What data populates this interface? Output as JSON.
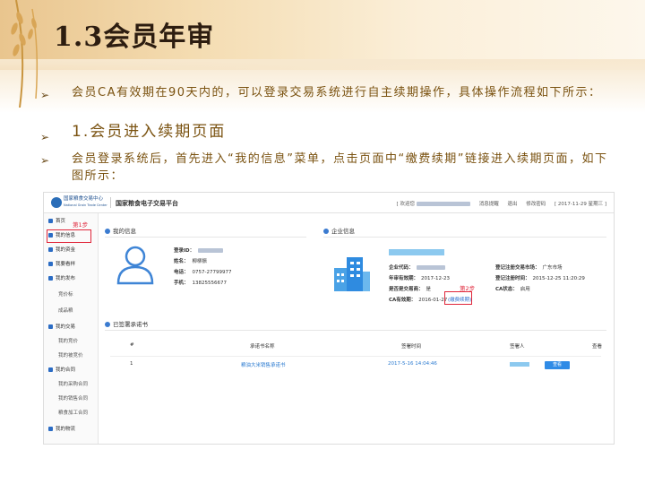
{
  "slide": {
    "title": "1.3会员年审",
    "bullets": [
      {
        "mark": "➢",
        "text": "会员CA有效期在90天内的，可以登录交易系统进行自主续期操作，具体操作流程如下所示："
      },
      {
        "mark": "➢",
        "text": "1.会员进入续期页面"
      },
      {
        "mark": "➢",
        "text": "会员登录系统后，首先进入“我的信息”菜单，点击页面中“缴费续期”链接进入续期页面，如下图所示："
      }
    ]
  },
  "screenshot": {
    "logo_text_cn": "国家粮食交易中心",
    "logo_text_en": "National Grain Trade Center",
    "platform": "国家粮食电子交易平台",
    "top_links": [
      "[ 欢迎您",
      "消息提醒",
      "退出",
      "修改密码",
      "[ 2017-11-29 星期三 ]"
    ],
    "sidebar": [
      {
        "label": "首页",
        "sub": false
      },
      {
        "label": "我的信息",
        "sub": false
      },
      {
        "label": "我的资金",
        "sub": false
      },
      {
        "label": "我要看样",
        "sub": false
      },
      {
        "label": "我的发布",
        "sub": false
      },
      {
        "label": "竞价标",
        "sub": true
      },
      {
        "label": "成品粮",
        "sub": true
      },
      {
        "label": "我的交易",
        "sub": false
      },
      {
        "label": "我的竞价",
        "sub": true
      },
      {
        "label": "我的被竞价",
        "sub": true
      },
      {
        "label": "我的合同",
        "sub": false
      },
      {
        "label": "我的采购合同",
        "sub": true
      },
      {
        "label": "我的销售合同",
        "sub": true
      },
      {
        "label": "粮食加工合同",
        "sub": true
      },
      {
        "label": "我的物流",
        "sub": false
      }
    ],
    "step1": "第1步",
    "step2": "第2步",
    "my_info": {
      "heading": "我的信息",
      "fields": [
        {
          "label": "登录ID：",
          "value": ""
        },
        {
          "label": "姓名：",
          "value": "柳柳振"
        },
        {
          "label": "电话：",
          "value": "0757-27799977"
        },
        {
          "label": "手机：",
          "value": "13825556677"
        }
      ]
    },
    "company_info": {
      "heading": "企业信息",
      "left": [
        {
          "label": "企业代码：",
          "value": ""
        },
        {
          "label": "年审有效期：",
          "value": "2017-12-23"
        },
        {
          "label": "是否是交易商：",
          "value": "是"
        },
        {
          "label": "CA有效期：",
          "value": "2016-01-27"
        }
      ],
      "right": [
        {
          "label": "登记注册交易市场：",
          "value": "广东市场"
        },
        {
          "label": "登记注册时间：",
          "value": "2015-12-25 11:20:29"
        },
        {
          "label": "CA状态：",
          "value": "启用"
        }
      ],
      "renew_link": "(缴费续期)"
    },
    "commitments": {
      "heading": "已签署承诺书",
      "columns": [
        "#",
        "承诺书名称",
        "签署时间",
        "签署人",
        "查看"
      ],
      "rows": [
        {
          "no": "1",
          "name": "粮油大米销售承诺书",
          "time": "2017-5-16 14:04:46",
          "signer": "",
          "action": "查看"
        }
      ]
    }
  }
}
